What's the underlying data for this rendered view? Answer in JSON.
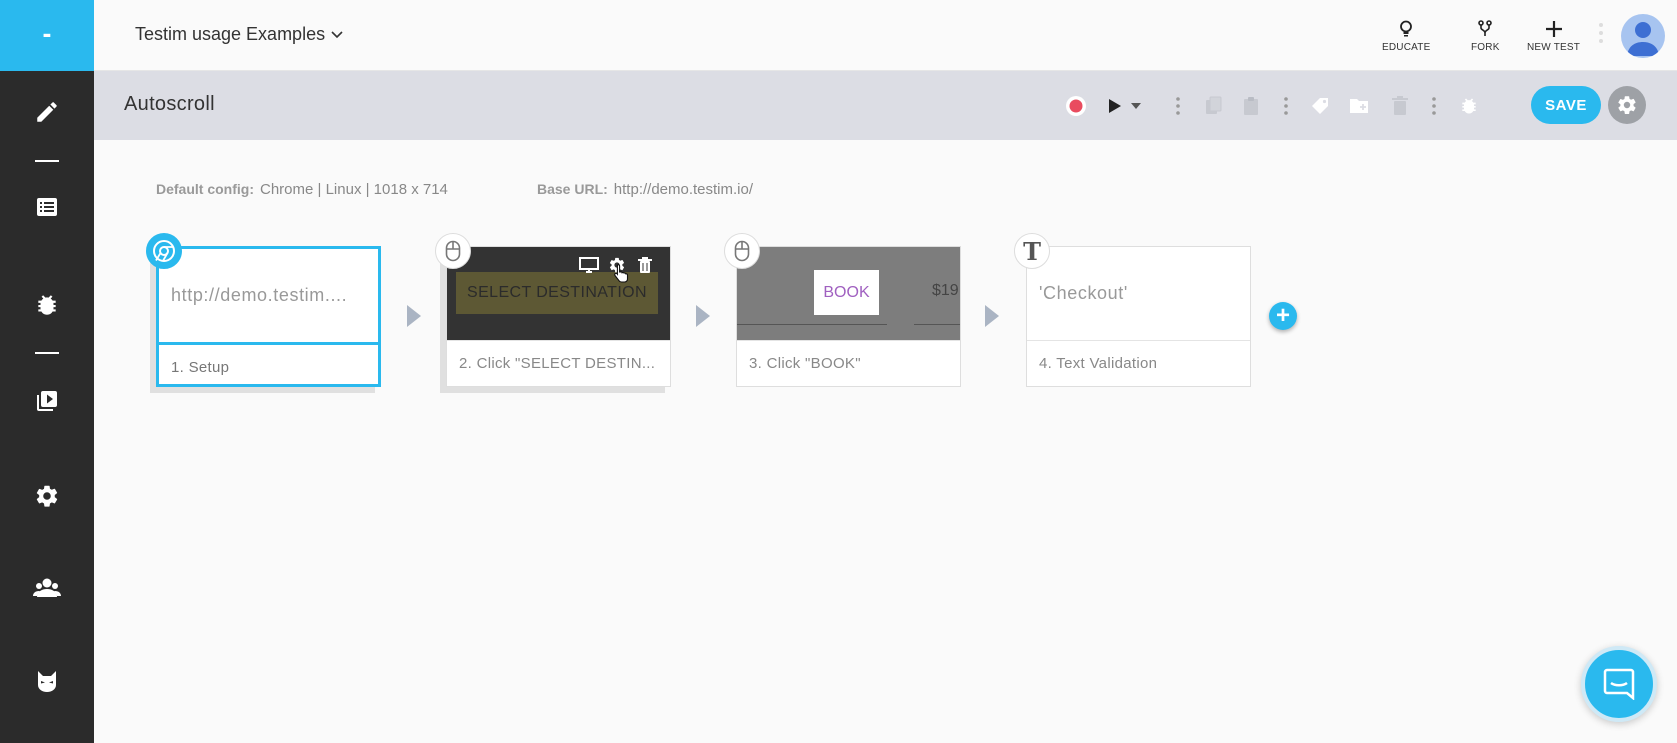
{
  "sidebar": {
    "logo_text": "-",
    "items": [
      {
        "name": "edit-icon"
      },
      {
        "name": "list-icon"
      },
      {
        "name": "bug-icon"
      },
      {
        "name": "runs-icon"
      },
      {
        "name": "settings-icon"
      },
      {
        "name": "team-icon"
      },
      {
        "name": "cat-mask-icon"
      }
    ]
  },
  "header": {
    "project_title": "Testim usage Examples",
    "actions": {
      "educate": "EDUCATE",
      "fork": "FORK",
      "new_test": "NEW TEST"
    }
  },
  "toolbar": {
    "test_name": "Autoscroll",
    "save_label": "SAVE"
  },
  "config": {
    "default_config_label": "Default config:",
    "default_config_value": "Chrome | Linux | 1018 x 714",
    "base_url_label": "Base URL:",
    "base_url_value": "http://demo.testim.io/"
  },
  "steps": [
    {
      "thumb_text": "http://demo.testim....",
      "caption": "1. Setup",
      "icon": "chrome-icon"
    },
    {
      "thumb_text": "SELECT DESTINATION",
      "caption": "2. Click \"SELECT DESTIN...",
      "icon": "mouse-icon"
    },
    {
      "thumb_text": "BOOK",
      "thumb_price": "$19",
      "caption": "3. Click \"BOOK\"",
      "icon": "mouse-icon"
    },
    {
      "thumb_text": "'Checkout'",
      "caption": "4. Text Validation",
      "icon": "text-icon"
    }
  ],
  "add_step_label": "+",
  "colors": {
    "accent": "#2ab9ee",
    "sidebar": "#2b2b2b",
    "toolbar": "#dcdde4",
    "record": "#e94b5f"
  }
}
